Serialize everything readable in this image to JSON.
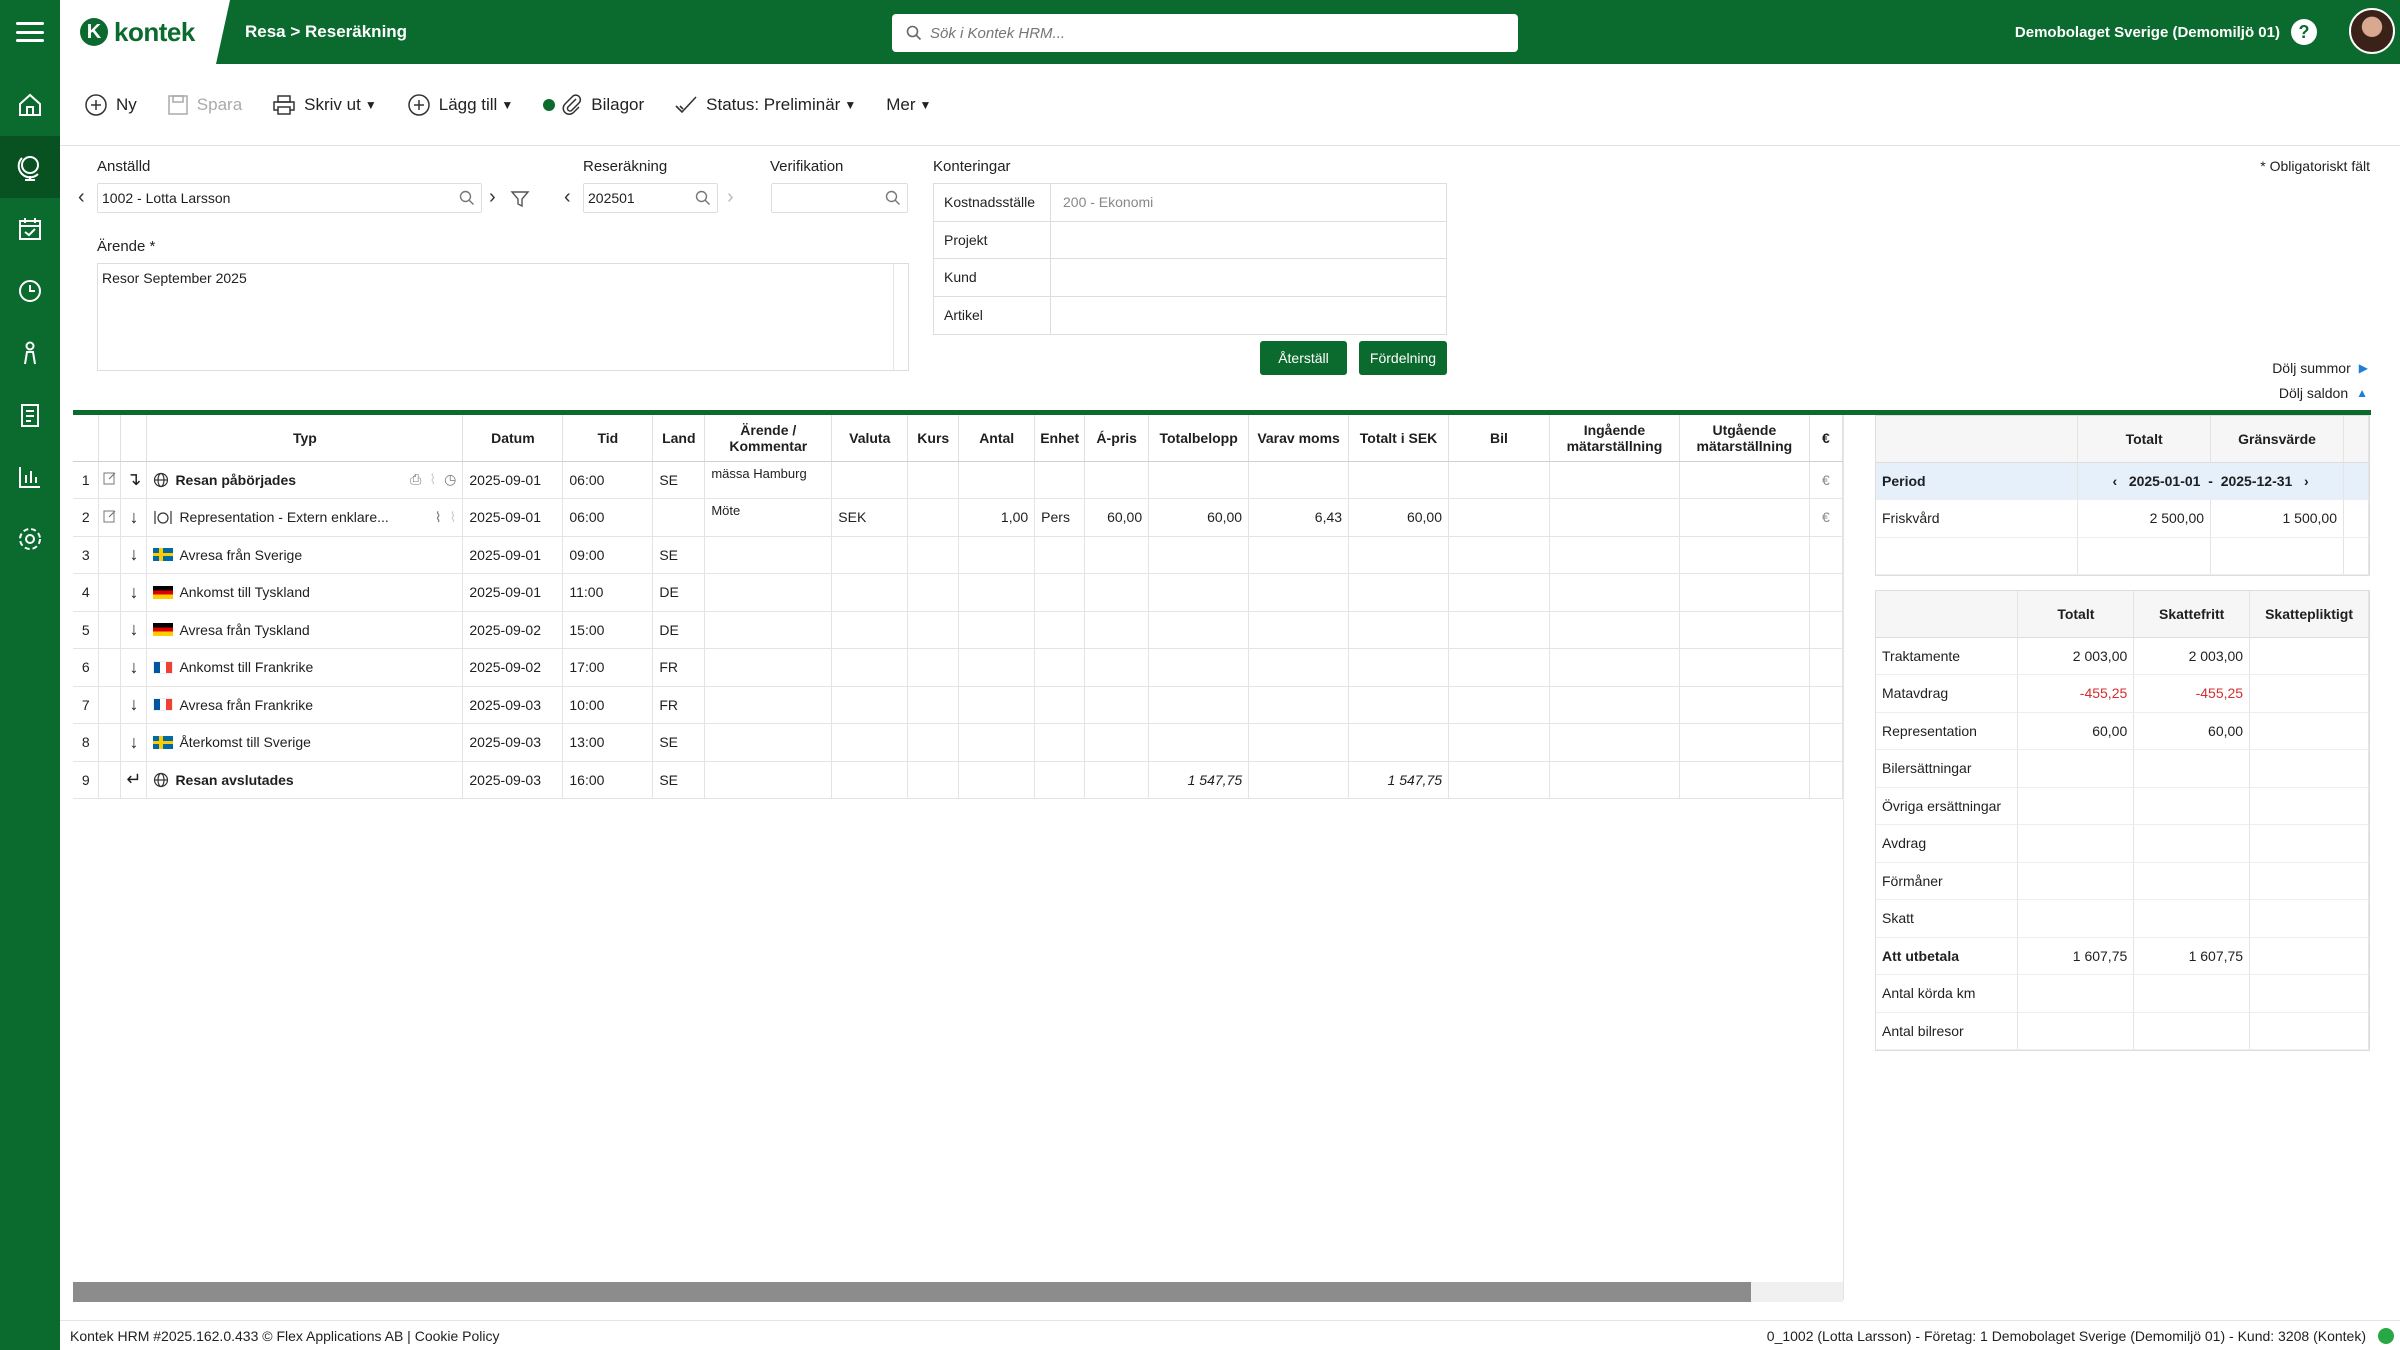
{
  "header": {
    "logo_text": "kontek",
    "breadcrumb": "Resa > Reseräkning",
    "search_placeholder": "Sök i Kontek HRM...",
    "company": "Demobolaget Sverige (Demomiljö 01)",
    "help": "?"
  },
  "toolbar": {
    "new": "Ny",
    "save": "Spara",
    "print": "Skriv ut",
    "add": "Lägg till",
    "attachments": "Bilagor",
    "status": "Status: Preliminär",
    "more": "Mer"
  },
  "form": {
    "employee_label": "Anställd",
    "employee_value": "1002 - Lotta Larsson",
    "report_label": "Reseräkning",
    "report_value": "202501",
    "verification_label": "Verifikation",
    "verification_value": "",
    "errand_label": "Ärende *",
    "errand_value": "Resor September 2025",
    "postings_label": "Konteringar",
    "postings": [
      {
        "label": "Kostnadsställe",
        "value": "200 - Ekonomi"
      },
      {
        "label": "Projekt",
        "value": ""
      },
      {
        "label": "Kund",
        "value": ""
      },
      {
        "label": "Artikel",
        "value": ""
      }
    ],
    "reset_button": "Återställ",
    "distribution_button": "Fördelning",
    "required_note": "* Obligatoriskt fält",
    "hide_sums": "Dölj summor",
    "hide_balances": "Dölj saldon"
  },
  "grid": {
    "columns": [
      "",
      "",
      "",
      "Typ",
      "Datum",
      "Tid",
      "Land",
      "Ärende / Kommentar",
      "Valuta",
      "Kurs",
      "Antal",
      "Enhet",
      "Á-pris",
      "Totalbelopp",
      "Varav moms",
      "Totalt i SEK",
      "Bil",
      "Ingående mätarställning",
      "Utgående mätarställning",
      "€"
    ],
    "rows": [
      {
        "n": "1",
        "type": "Resan påbörjades",
        "bold": true,
        "icon": "globe",
        "date": "2025-09-01",
        "time": "06:00",
        "country": "SE",
        "comment": "mässa Hamburg",
        "currency": "",
        "rate": "",
        "qty": "",
        "unit": "",
        "price": "",
        "total": "",
        "vat": "",
        "total_sek": "",
        "car": "",
        "in": "",
        "out": ""
      },
      {
        "n": "2",
        "type": "Representation - Extern enklare...",
        "bold": false,
        "icon": "dining",
        "date": "2025-09-01",
        "time": "06:00",
        "country": "",
        "comment": "Möte",
        "currency": "SEK",
        "rate": "",
        "qty": "1,00",
        "unit": "Pers",
        "price": "60,00",
        "total": "60,00",
        "vat": "6,43",
        "total_sek": "60,00",
        "car": "",
        "in": "",
        "out": ""
      },
      {
        "n": "3",
        "type": "Avresa från Sverige",
        "bold": false,
        "icon": "se",
        "date": "2025-09-01",
        "time": "09:00",
        "country": "SE",
        "comment": "",
        "currency": "",
        "rate": "",
        "qty": "",
        "unit": "",
        "price": "",
        "total": "",
        "vat": "",
        "total_sek": "",
        "car": "",
        "in": "",
        "out": ""
      },
      {
        "n": "4",
        "type": "Ankomst till Tyskland",
        "bold": false,
        "icon": "de",
        "date": "2025-09-01",
        "time": "11:00",
        "country": "DE",
        "comment": "",
        "currency": "",
        "rate": "",
        "qty": "",
        "unit": "",
        "price": "",
        "total": "",
        "vat": "",
        "total_sek": "",
        "car": "",
        "in": "",
        "out": ""
      },
      {
        "n": "5",
        "type": "Avresa från Tyskland",
        "bold": false,
        "icon": "de",
        "date": "2025-09-02",
        "time": "15:00",
        "country": "DE",
        "comment": "",
        "currency": "",
        "rate": "",
        "qty": "",
        "unit": "",
        "price": "",
        "total": "",
        "vat": "",
        "total_sek": "",
        "car": "",
        "in": "",
        "out": ""
      },
      {
        "n": "6",
        "type": "Ankomst till Frankrike",
        "bold": false,
        "icon": "fr",
        "date": "2025-09-02",
        "time": "17:00",
        "country": "FR",
        "comment": "",
        "currency": "",
        "rate": "",
        "qty": "",
        "unit": "",
        "price": "",
        "total": "",
        "vat": "",
        "total_sek": "",
        "car": "",
        "in": "",
        "out": ""
      },
      {
        "n": "7",
        "type": "Avresa från Frankrike",
        "bold": false,
        "icon": "fr",
        "date": "2025-09-03",
        "time": "10:00",
        "country": "FR",
        "comment": "",
        "currency": "",
        "rate": "",
        "qty": "",
        "unit": "",
        "price": "",
        "total": "",
        "vat": "",
        "total_sek": "",
        "car": "",
        "in": "",
        "out": ""
      },
      {
        "n": "8",
        "type": "Återkomst till Sverige",
        "bold": false,
        "icon": "se",
        "date": "2025-09-03",
        "time": "13:00",
        "country": "SE",
        "comment": "",
        "currency": "",
        "rate": "",
        "qty": "",
        "unit": "",
        "price": "",
        "total": "",
        "vat": "",
        "total_sek": "",
        "car": "",
        "in": "",
        "out": ""
      },
      {
        "n": "9",
        "type": "Resan avslutades",
        "bold": true,
        "icon": "globe",
        "date": "2025-09-03",
        "time": "16:00",
        "country": "SE",
        "comment": "",
        "currency": "",
        "rate": "",
        "qty": "",
        "unit": "",
        "price": "",
        "total": "1 547,75",
        "vat": "",
        "total_sek": "1 547,75",
        "car": "",
        "in": "",
        "out": ""
      }
    ]
  },
  "balances": {
    "columns": [
      "",
      "Totalt",
      "Gränsvärde"
    ],
    "period_label": "Period",
    "period_from": "2025-01-01",
    "period_sep": "-",
    "period_to": "2025-12-31",
    "rows": [
      {
        "label": "Friskvård",
        "total": "2 500,00",
        "limit": "1 500,00"
      }
    ]
  },
  "sums": {
    "columns": [
      "",
      "Totalt",
      "Skattefritt",
      "Skattepliktigt"
    ],
    "rows": [
      {
        "label": "Traktamente",
        "total": "2 003,00",
        "free": "2 003,00",
        "taxable": "",
        "neg": false,
        "bold": false
      },
      {
        "label": "Matavdrag",
        "total": "-455,25",
        "free": "-455,25",
        "taxable": "",
        "neg": true,
        "bold": false
      },
      {
        "label": "Representation",
        "total": "60,00",
        "free": "60,00",
        "taxable": "",
        "neg": false,
        "bold": false
      },
      {
        "label": "Bilersättningar",
        "total": "",
        "free": "",
        "taxable": "",
        "neg": false,
        "bold": false
      },
      {
        "label": "Övriga ersättningar",
        "total": "",
        "free": "",
        "taxable": "",
        "neg": false,
        "bold": false
      },
      {
        "label": "Avdrag",
        "total": "",
        "free": "",
        "taxable": "",
        "neg": false,
        "bold": false
      },
      {
        "label": "Förmåner",
        "total": "",
        "free": "",
        "taxable": "",
        "neg": false,
        "bold": false
      },
      {
        "label": "Skatt",
        "total": "",
        "free": "",
        "taxable": "",
        "neg": false,
        "bold": false
      },
      {
        "label": "Att utbetala",
        "total": "1 607,75",
        "free": "1 607,75",
        "taxable": "",
        "neg": false,
        "bold": true
      },
      {
        "label": "Antal körda km",
        "total": "",
        "free": "",
        "taxable": "",
        "neg": false,
        "bold": false
      },
      {
        "label": "Antal bilresor",
        "total": "",
        "free": "",
        "taxable": "",
        "neg": false,
        "bold": false
      }
    ]
  },
  "footer": {
    "left": "Kontek HRM #2025.162.0.433 © Flex Applications AB | Cookie Policy",
    "right": "0_1002 (Lotta Larsson) - Företag: 1 Demobolaget Sverige (Demomiljö 01) - Kund: 3208 (Kontek)"
  },
  "colors": {
    "brand": "#0b6b2e",
    "negative": "#d32f2f",
    "period_bg": "#e6f0fb"
  }
}
